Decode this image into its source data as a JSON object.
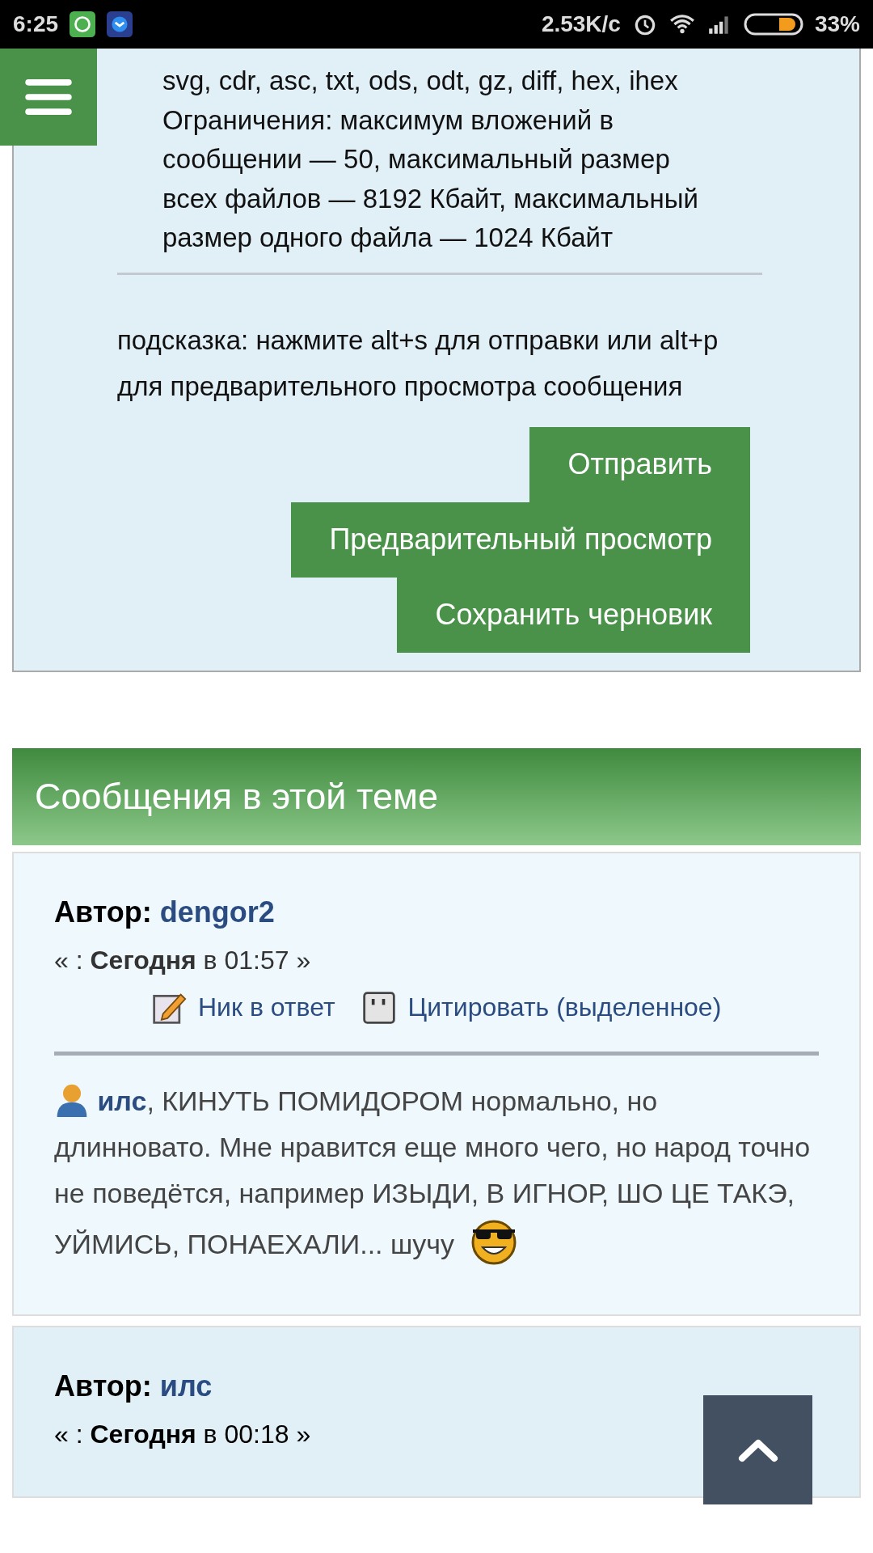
{
  "status_bar": {
    "time": "6:25",
    "net_speed": "2.53K/с",
    "battery": "33%"
  },
  "attachments_info": {
    "extensions_lines": [
      "svg, cdr, asc, txt, ods, odt, gz, diff, hex, ihex"
    ],
    "limits_lines": [
      "Ограничения: максимум вложений в",
      "сообщении — 50, максимальный размер",
      "всех файлов — 8192 Кбайт, максимальный",
      "размер одного файла — 1024 Кбайт"
    ]
  },
  "hint": "подсказка: нажмите alt+s для отправки или alt+p для предварительного просмотра сообщения",
  "buttons": [
    "Отправить",
    "Предварительный просмотр",
    "Сохранить черновик"
  ],
  "section_title": "Сообщения в этой теме",
  "posts": [
    {
      "author_label": "Автор:",
      "author": "dengor2",
      "date": "« : **Сегодня** в 01:57 »",
      "actions": [
        {
          "kind": "nick",
          "label": "Ник в ответ"
        },
        {
          "kind": "quote",
          "label": "Цитировать (выделенное)"
        }
      ],
      "body": {
        "mention": "илс",
        "text": ", КИНУТЬ ПОМИДОРОМ нормально, но длинновато. Мне нравится еще много чего, но народ точно не поведётся, например ИЗЫДИ, В ИГНОР, ШО ЦЕ ТАКЭ, УЙМИСЬ, ПОНАЕХАЛИ... шучу"
      }
    },
    {
      "author_label": "Автор:",
      "author": "илс",
      "date": "« : **Сегодня** в 00:18 »"
    }
  ]
}
